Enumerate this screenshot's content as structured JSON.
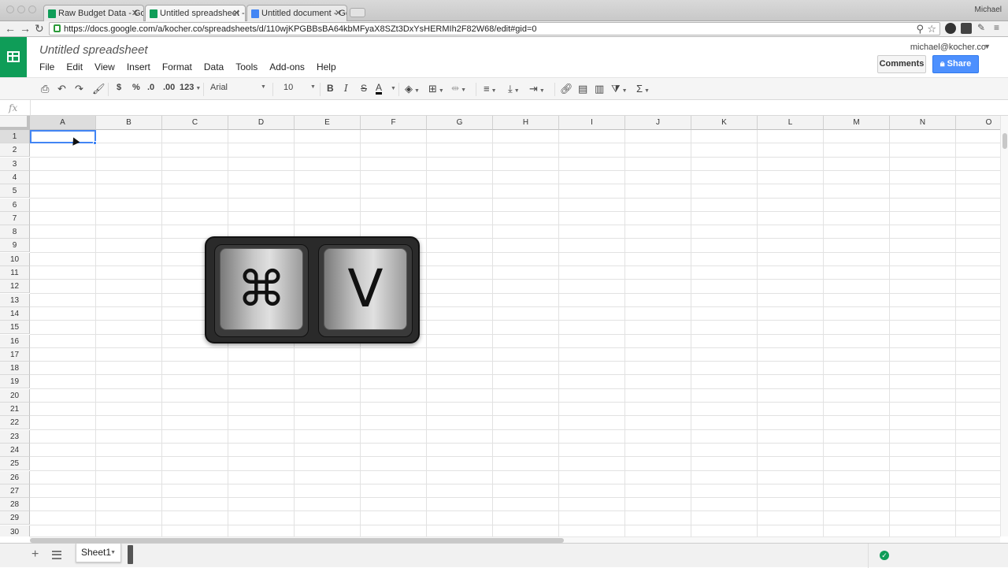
{
  "browser": {
    "tabs": [
      {
        "label": "Raw Budget Data - Google",
        "icon": "sheets-favicon"
      },
      {
        "label": "Untitled spreadsheet - Goo",
        "icon": "sheets-favicon"
      },
      {
        "label": "Untitled document - Google",
        "icon": "docs-favicon"
      }
    ],
    "profile_name": "Michael",
    "url": "https://docs.google.com/a/kocher.co/spreadsheets/d/110wjKPGBBsBA64kbMFyaX8SZt3DxYsHERMIh2F82W68/edit#gid=0"
  },
  "document": {
    "title": "Untitled spreadsheet",
    "account": "michael@kocher.co",
    "comments_label": "Comments",
    "share_label": "Share"
  },
  "menu": [
    "File",
    "Edit",
    "View",
    "Insert",
    "Format",
    "Data",
    "Tools",
    "Add-ons",
    "Help"
  ],
  "toolbar": {
    "currency": "$",
    "percent": "%",
    "decrease_decimals": ".0",
    "increase_decimals": ".00",
    "more_formats": "123",
    "font": "Arial",
    "font_size": "10",
    "bold": "B",
    "italic": "I",
    "strikethrough": "S",
    "text_color": "A",
    "sigma": "Σ"
  },
  "formula_bar": {
    "fx_label": "fx",
    "value": ""
  },
  "grid": {
    "columns": [
      "A",
      "B",
      "C",
      "D",
      "E",
      "F",
      "G",
      "H",
      "I",
      "J",
      "K",
      "L",
      "M",
      "N",
      "O"
    ],
    "rows": [
      "1",
      "2",
      "3",
      "4",
      "5",
      "6",
      "7",
      "8",
      "9",
      "10",
      "11",
      "12",
      "13",
      "14",
      "15",
      "16",
      "17",
      "18",
      "19",
      "20",
      "21",
      "22",
      "23",
      "24",
      "25",
      "26",
      "27",
      "28",
      "29",
      "30"
    ],
    "selected_cell": "A1"
  },
  "sheets": [
    {
      "name": "Sheet1"
    }
  ],
  "overlay": {
    "keys": [
      "⌘",
      "V"
    ]
  }
}
